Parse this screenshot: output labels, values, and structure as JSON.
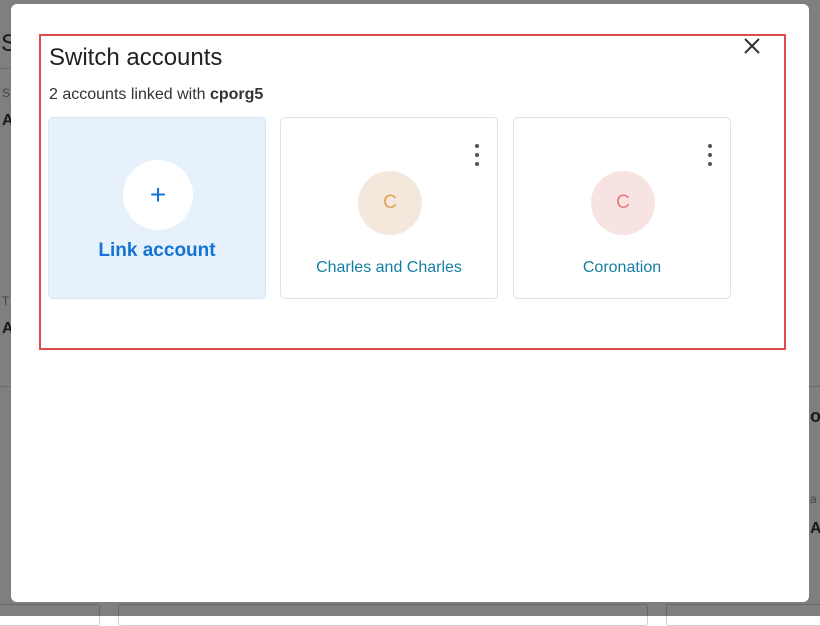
{
  "modal": {
    "title": "Switch accounts",
    "subtitle_prefix": "2 accounts linked with ",
    "subtitle_org": "cporg5",
    "close_icon": "close-icon",
    "highlight_color": "#e04a4a"
  },
  "link_card": {
    "icon": "plus-icon",
    "plus_glyph": "+",
    "label": "Link account",
    "accent": "#1474d4"
  },
  "accounts": [
    {
      "initial": "C",
      "name": "Charles and Charles",
      "avatar_bg": "#f4e8dc",
      "avatar_fg": "#e0a25a",
      "menu_icon": "kebab-menu-icon"
    },
    {
      "initial": "C",
      "name": "Coronation",
      "avatar_bg": "#f8e3e3",
      "avatar_fg": "#e87b7b",
      "menu_icon": "kebab-menu-icon"
    }
  ]
}
